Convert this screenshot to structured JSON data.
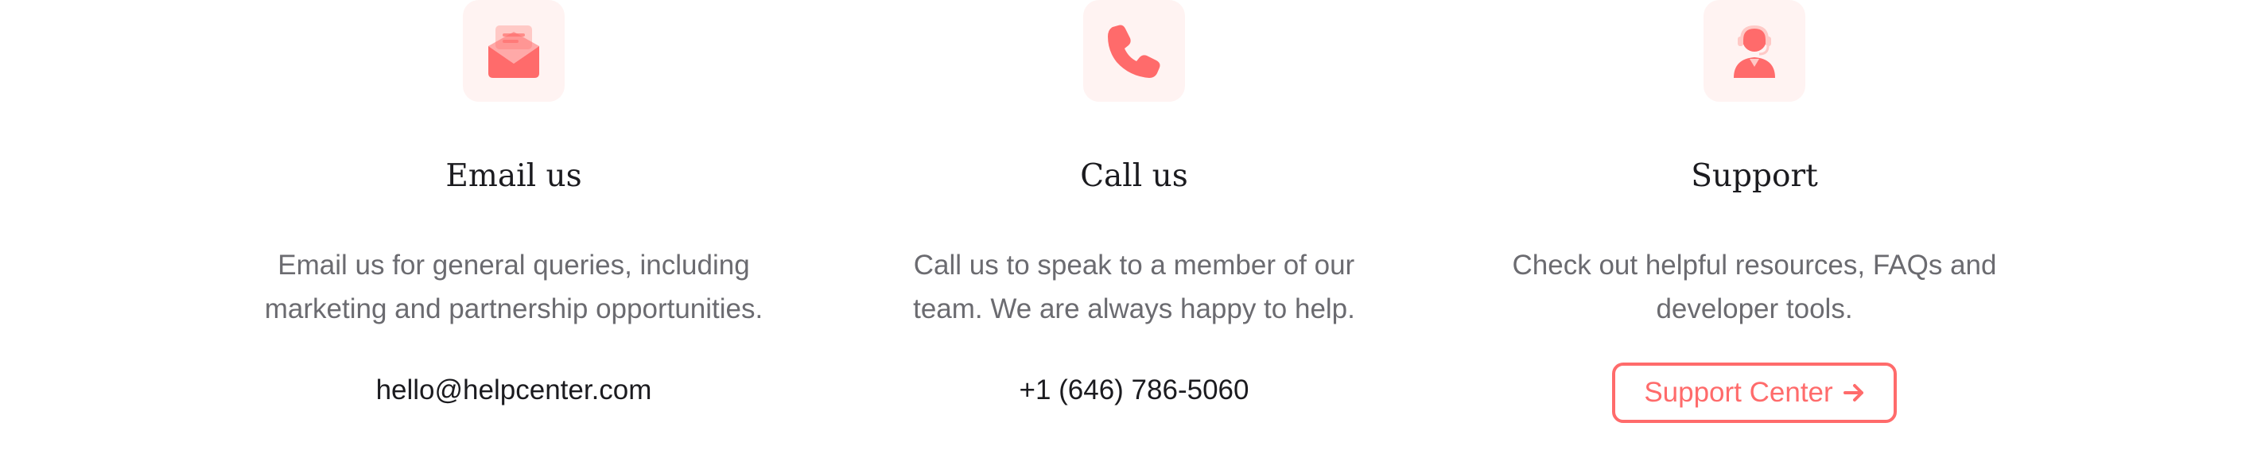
{
  "colors": {
    "accent": "#ff6b6b",
    "tile_bg": "#fff3f2",
    "heading": "#1b1b1f",
    "body_text": "#6b6b70"
  },
  "columns": [
    {
      "icon": "envelope-open-icon",
      "title": "Email us",
      "desc_line1": "Email us for general queries, including",
      "desc_line2": "marketing and partnership opportunities.",
      "contact": "hello@helpcenter.com"
    },
    {
      "icon": "phone-icon",
      "title": "Call us",
      "desc_line1": "Call us to speak to a member of our",
      "desc_line2": "team. We are always happy to help.",
      "contact": "+1 (646) 786-5060"
    },
    {
      "icon": "support-agent-icon",
      "title": "Support",
      "desc_line1": "Check out helpful resources, FAQs and",
      "desc_line2": "developer tools.",
      "button_label": "Support Center",
      "button_icon": "arrow-right-icon"
    }
  ]
}
